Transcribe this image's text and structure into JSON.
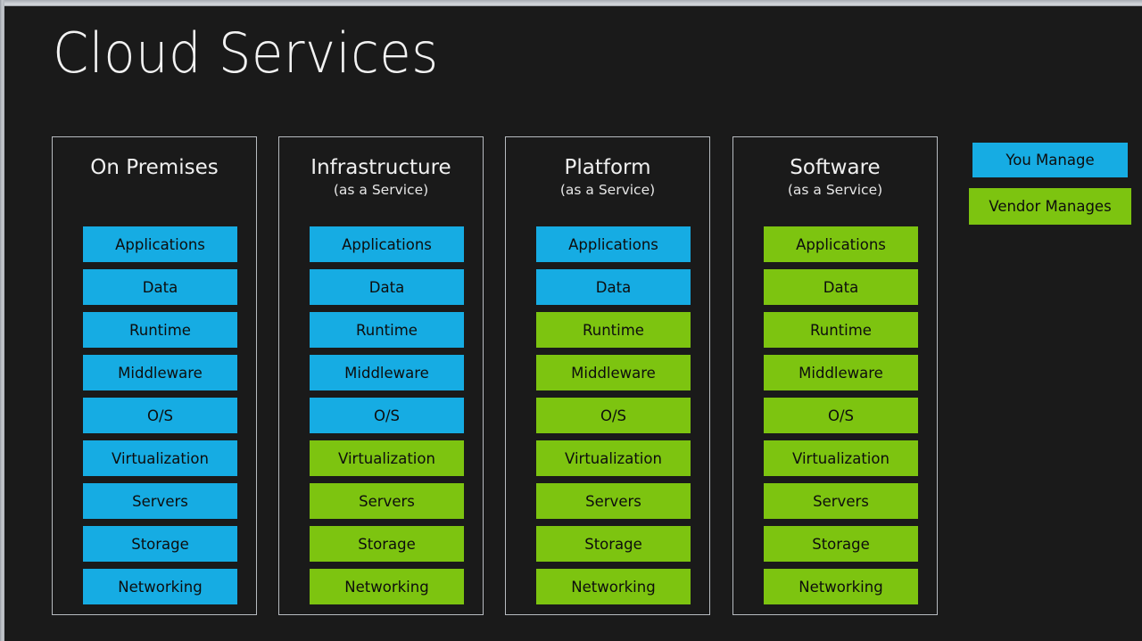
{
  "slide": {
    "title": "Cloud Services",
    "background_color": "#1a1a1a",
    "frame_color": "#c3c7cc"
  },
  "palette": {
    "you_manage": "#16ace3",
    "vendor_manages": "#7dc410",
    "card_border": "#b7bbc0",
    "title_text": "#f2f2f2",
    "block_text": "#0d0d0d"
  },
  "legend": {
    "you_manage": "You Manage",
    "vendor_manages": "Vendor Manages"
  },
  "layer_names": [
    "Applications",
    "Data",
    "Runtime",
    "Middleware",
    "O/S",
    "Virtualization",
    "Servers",
    "Storage",
    "Networking"
  ],
  "columns": [
    {
      "title": "On Premises",
      "subtitle": "",
      "layers": [
        {
          "label": "Applications",
          "owner": "you"
        },
        {
          "label": "Data",
          "owner": "you"
        },
        {
          "label": "Runtime",
          "owner": "you"
        },
        {
          "label": "Middleware",
          "owner": "you"
        },
        {
          "label": "O/S",
          "owner": "you"
        },
        {
          "label": "Virtualization",
          "owner": "you"
        },
        {
          "label": "Servers",
          "owner": "you"
        },
        {
          "label": "Storage",
          "owner": "you"
        },
        {
          "label": "Networking",
          "owner": "you"
        }
      ]
    },
    {
      "title": "Infrastructure",
      "subtitle": "(as a Service)",
      "layers": [
        {
          "label": "Applications",
          "owner": "you"
        },
        {
          "label": "Data",
          "owner": "you"
        },
        {
          "label": "Runtime",
          "owner": "you"
        },
        {
          "label": "Middleware",
          "owner": "you"
        },
        {
          "label": "O/S",
          "owner": "you"
        },
        {
          "label": "Virtualization",
          "owner": "vendor"
        },
        {
          "label": "Servers",
          "owner": "vendor"
        },
        {
          "label": "Storage",
          "owner": "vendor"
        },
        {
          "label": "Networking",
          "owner": "vendor"
        }
      ]
    },
    {
      "title": "Platform",
      "subtitle": "(as a Service)",
      "layers": [
        {
          "label": "Applications",
          "owner": "you"
        },
        {
          "label": "Data",
          "owner": "you"
        },
        {
          "label": "Runtime",
          "owner": "vendor"
        },
        {
          "label": "Middleware",
          "owner": "vendor"
        },
        {
          "label": "O/S",
          "owner": "vendor"
        },
        {
          "label": "Virtualization",
          "owner": "vendor"
        },
        {
          "label": "Servers",
          "owner": "vendor"
        },
        {
          "label": "Storage",
          "owner": "vendor"
        },
        {
          "label": "Networking",
          "owner": "vendor"
        }
      ]
    },
    {
      "title": "Software",
      "subtitle": "(as a Service)",
      "layers": [
        {
          "label": "Applications",
          "owner": "vendor"
        },
        {
          "label": "Data",
          "owner": "vendor"
        },
        {
          "label": "Runtime",
          "owner": "vendor"
        },
        {
          "label": "Middleware",
          "owner": "vendor"
        },
        {
          "label": "O/S",
          "owner": "vendor"
        },
        {
          "label": "Virtualization",
          "owner": "vendor"
        },
        {
          "label": "Servers",
          "owner": "vendor"
        },
        {
          "label": "Storage",
          "owner": "vendor"
        },
        {
          "label": "Networking",
          "owner": "vendor"
        }
      ]
    }
  ]
}
